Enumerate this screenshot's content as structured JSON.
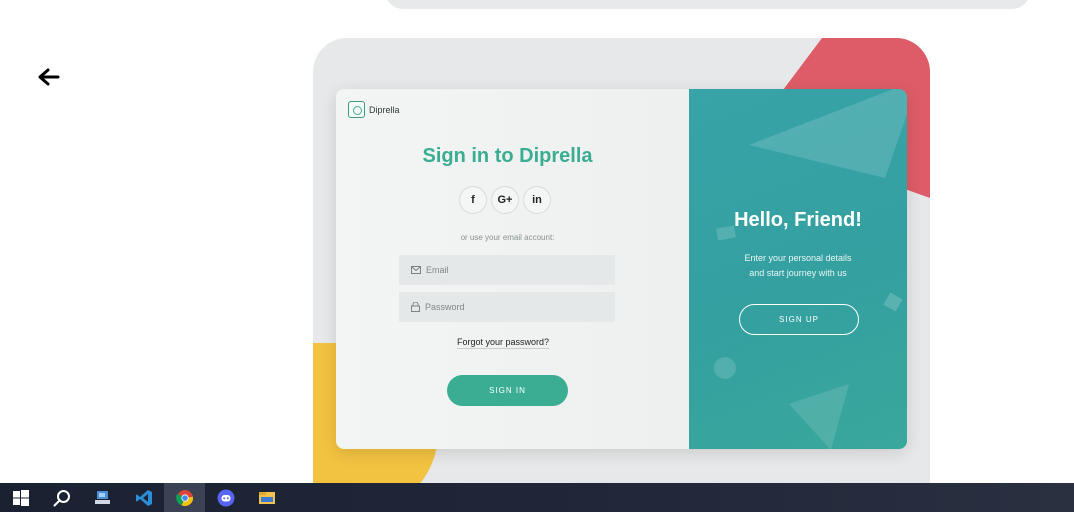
{
  "signin": {
    "brand": "Diprella",
    "title": "Sign in to Diprella",
    "socials": [
      "f",
      "G+",
      "in"
    ],
    "alt_text": "or use your email account:",
    "email_placeholder": "Email",
    "password_placeholder": "Password",
    "forgot": "Forgot your password?",
    "button": "SIGN IN"
  },
  "signup": {
    "title": "Hello, Friend!",
    "line1": "Enter your personal details",
    "line2": "and start journey with us",
    "button": "SIGN UP"
  },
  "taskbar": {
    "items": [
      "start-icon",
      "search-icon",
      "app-icon",
      "vscode-icon",
      "chrome-icon",
      "discord-icon",
      "file-explorer-icon"
    ],
    "active": "chrome-icon"
  },
  "colors": {
    "accent": "#3aad92",
    "panel": "#38a3a8",
    "red": "#dd5c67",
    "yellow": "#f2c241"
  }
}
